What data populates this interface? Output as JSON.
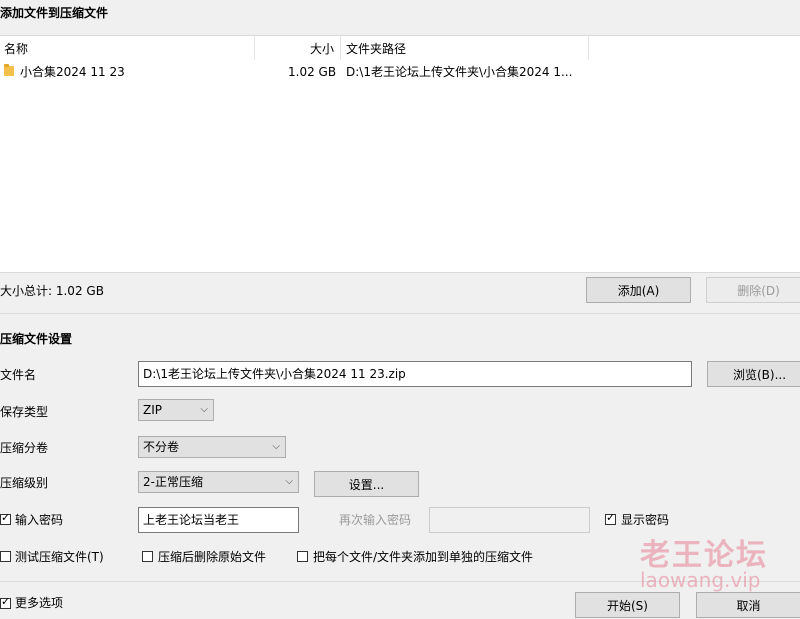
{
  "header": {
    "title": "添加文件到压缩文件"
  },
  "filelist": {
    "columns": {
      "name": "名称",
      "size": "大小",
      "path": "文件夹路径"
    },
    "rows": [
      {
        "name": "小合集2024 11 23",
        "size": "1.02 GB",
        "path": "D:\\1老王论坛上传文件夹\\小合集2024 1..."
      }
    ]
  },
  "summary": {
    "total_label": "大小总计: 1.02 GB"
  },
  "buttons": {
    "add": "添加(A)",
    "remove": "删除(D)",
    "browse": "浏览(B)...",
    "settings": "设置...",
    "start": "开始(S)",
    "cancel": "取消"
  },
  "settings": {
    "title": "压缩文件设置",
    "filename_label": "文件名",
    "filename_value": "D:\\1老王论坛上传文件夹\\小合集2024 11 23.zip",
    "type_label": "保存类型",
    "type_value": "ZIP",
    "split_label": "压缩分卷",
    "split_value": "不分卷",
    "level_label": "压缩级别",
    "level_value": "2-正常压缩",
    "password_label": "输入密码",
    "password_checked": true,
    "password_value": "上老王论坛当老王",
    "repeat_label": "再次输入密码",
    "repeat_value": "",
    "show_password_label": "显示密码",
    "show_password_checked": true,
    "test_label": "测试压缩文件(T)",
    "delete_after_label": "压缩后删除原始文件",
    "separate_label": "把每个文件/文件夹添加到单独的压缩文件",
    "more_options_label": "更多选项"
  },
  "watermark": {
    "text1": "老王论坛",
    "text2": "laowang.vip"
  }
}
